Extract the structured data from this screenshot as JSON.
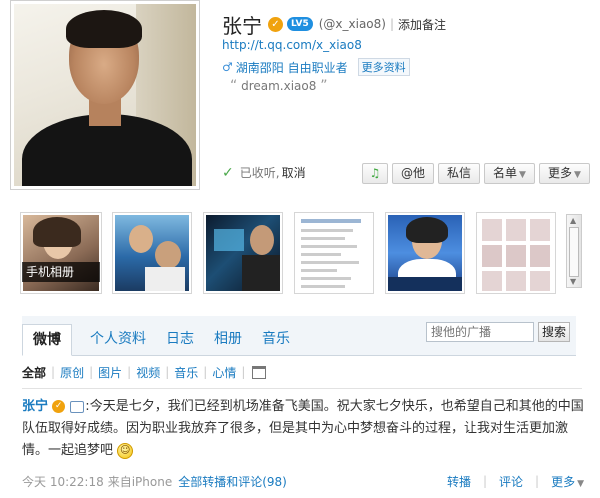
{
  "profile": {
    "name": "张宁",
    "verify_badge": "✓",
    "level_badge": "LV5",
    "handle": "(@x_xiao8)",
    "separator": "|",
    "add_note": "添加备注",
    "url": "http://t.qq.com/x_xiao8",
    "gender_icon": "♂",
    "location": "湖南邵阳 自由职业者",
    "more_info": "更多资料",
    "motto": "dream.xiao8",
    "quote_open": "“",
    "quote_close": "”"
  },
  "follow": {
    "check_icon": "✓",
    "status": "已收听,",
    "cancel": "取消"
  },
  "actions": {
    "listen_icon": "♫",
    "at": "@他",
    "message": "私信",
    "list": "名单",
    "more": "更多",
    "dropdown_arrow": "▼"
  },
  "photos": {
    "phone_album": "手机相册"
  },
  "tabs": [
    "微博",
    "个人资料",
    "日志",
    "相册",
    "音乐"
  ],
  "search": {
    "placeholder": "搜他的广播",
    "button": "搜索"
  },
  "filters": [
    "全部",
    "原创",
    "图片",
    "视频",
    "音乐",
    "心情"
  ],
  "filter_separator": "|",
  "post": {
    "author": "张宁",
    "author_badge": "✓",
    "separator": ":",
    "text": "今天是七夕，我们已经到机场准备飞美国。祝大家七夕快乐，也希望自己和其他的中国队伍取得好成绩。因为职业我放弃了很多，但是其中为心中梦想奋斗的过程，让我对生活更加激情。一起追梦吧",
    "emoji": "☺",
    "time": "今天 10:22:18",
    "source": "来自iPhone",
    "comments_link": "全部转播和评论(98)",
    "repost": "转播",
    "comment": "评论",
    "more": "更多",
    "action_separator": "|"
  }
}
